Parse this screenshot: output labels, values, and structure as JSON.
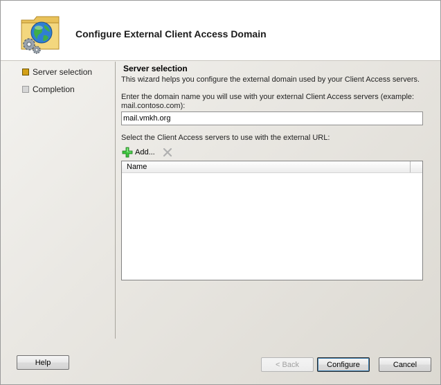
{
  "wizard": {
    "title": "Configure External Client Access Domain",
    "icon": "globe-folder-gear-icon"
  },
  "steps": [
    {
      "label": "Server selection",
      "state": "active"
    },
    {
      "label": "Completion",
      "state": "pending"
    }
  ],
  "content": {
    "section_title": "Server selection",
    "intro": "This wizard helps you configure the external domain used by your Client Access servers.",
    "domain_prompt": "Enter the domain name you will use with your external Client Access servers (example: mail.contoso.com):",
    "domain_value": "mail.vmkh.org",
    "servers_prompt": "Select the Client Access servers to use with the external URL:",
    "add_label": "Add...",
    "list_columns": [
      "Name"
    ],
    "list_rows": []
  },
  "buttons": {
    "help": "Help",
    "back": "< Back",
    "configure": "Configure",
    "cancel": "Cancel"
  },
  "colors": {
    "active_step": "#d4a017",
    "pending_step": "#d6d6d6",
    "add_icon": "#2ea82e"
  }
}
